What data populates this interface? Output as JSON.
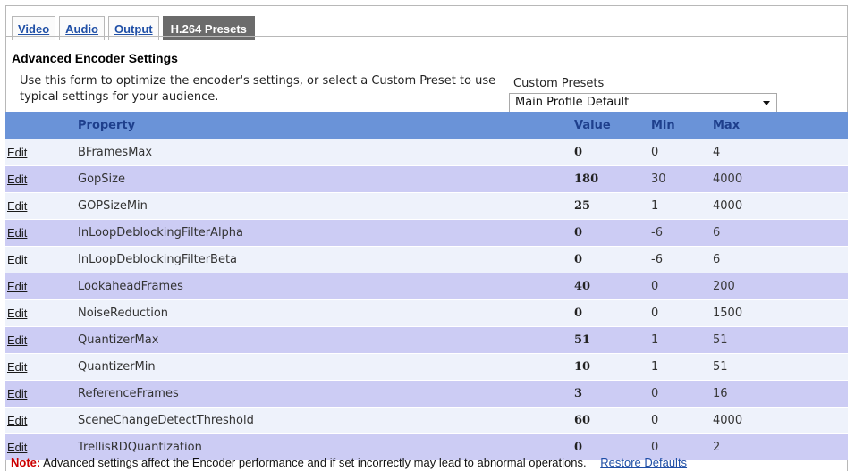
{
  "tabs": [
    {
      "label": "Video",
      "active": false
    },
    {
      "label": "Audio",
      "active": false
    },
    {
      "label": "Output",
      "active": false
    },
    {
      "label": "H.264 Presets",
      "active": true
    }
  ],
  "section": {
    "title": "Advanced Encoder Settings",
    "description": "Use this form to optimize the encoder's settings, or select a Custom Preset to use typical settings for your audience."
  },
  "custom_presets": {
    "label": "Custom Presets",
    "selected": "Main Profile Default"
  },
  "table": {
    "headers": {
      "edit": "",
      "property": "Property",
      "value": "Value",
      "min": "Min",
      "max": "Max"
    },
    "edit_label": "Edit",
    "rows": [
      {
        "property": "BFramesMax",
        "value": "0",
        "min": "0",
        "max": "4"
      },
      {
        "property": "GopSize",
        "value": "180",
        "min": "30",
        "max": "4000"
      },
      {
        "property": "GOPSizeMin",
        "value": "25",
        "min": "1",
        "max": "4000"
      },
      {
        "property": "InLoopDeblockingFilterAlpha",
        "value": "0",
        "min": "-6",
        "max": "6"
      },
      {
        "property": "InLoopDeblockingFilterBeta",
        "value": "0",
        "min": "-6",
        "max": "6"
      },
      {
        "property": "LookaheadFrames",
        "value": "40",
        "min": "0",
        "max": "200"
      },
      {
        "property": "NoiseReduction",
        "value": "0",
        "min": "0",
        "max": "1500"
      },
      {
        "property": "QuantizerMax",
        "value": "51",
        "min": "1",
        "max": "51"
      },
      {
        "property": "QuantizerMin",
        "value": "10",
        "min": "1",
        "max": "51"
      },
      {
        "property": "ReferenceFrames",
        "value": "3",
        "min": "0",
        "max": "16"
      },
      {
        "property": "SceneChangeDetectThreshold",
        "value": "60",
        "min": "0",
        "max": "4000"
      },
      {
        "property": "TrellisRDQuantization",
        "value": "0",
        "min": "0",
        "max": "2"
      }
    ]
  },
  "note": {
    "label": "Note:",
    "text": "Advanced settings affect the Encoder performance and if set incorrectly may lead to abnormal operations.",
    "restore_label": "Restore Defaults"
  },
  "colors": {
    "header_bg": "#6a93d8",
    "row_odd": "#eef2fb",
    "row_even": "#ccccf4",
    "active_tab": "#6b6b6b",
    "link": "#1f4fa6",
    "note_label": "#cc0000"
  }
}
